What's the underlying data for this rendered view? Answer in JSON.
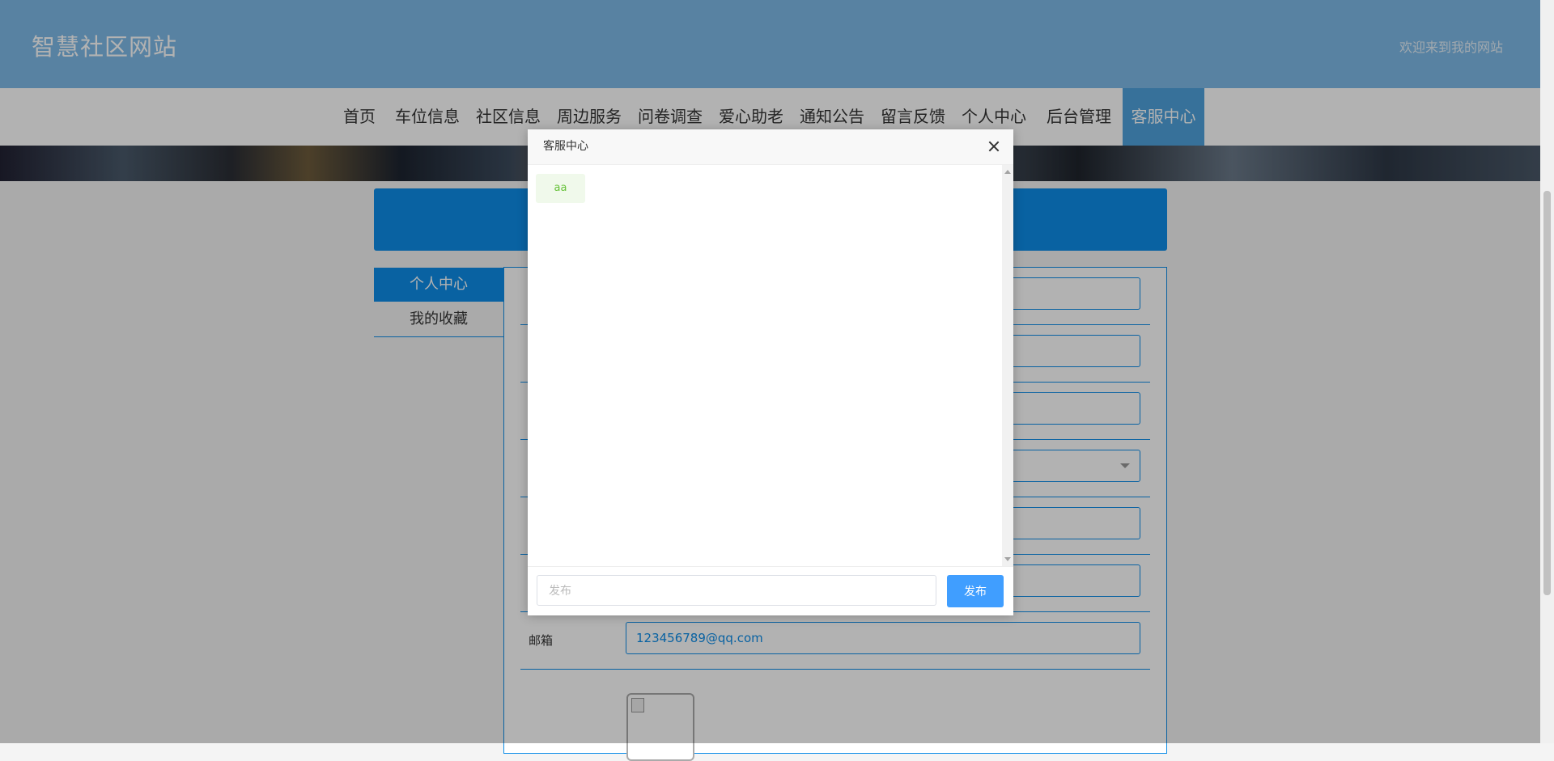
{
  "header": {
    "site_title": "智慧社区网站",
    "welcome_text": "欢迎来到我的网站"
  },
  "nav": {
    "items": [
      {
        "label": "首页"
      },
      {
        "label": "车位信息"
      },
      {
        "label": "社区信息"
      },
      {
        "label": "周边服务"
      },
      {
        "label": "问卷调查"
      },
      {
        "label": "爱心助老"
      },
      {
        "label": "通知公告"
      },
      {
        "label": "留言反馈"
      },
      {
        "label": "个人中心"
      },
      {
        "label": "后台管理"
      },
      {
        "label": "客服中心",
        "active": true
      }
    ]
  },
  "sidebar": {
    "items": [
      {
        "label": "个人中心",
        "active": true
      },
      {
        "label": "我的收藏"
      }
    ]
  },
  "form": {
    "email_label": "邮箱",
    "email_value": "123456789@qq.com"
  },
  "dialog": {
    "title": "客服中心",
    "messages": [
      {
        "text": "aa"
      }
    ],
    "input_placeholder": "发布",
    "send_label": "发布"
  },
  "colors": {
    "header_bg": "#7fbbe8",
    "primary": "#0d8de8",
    "send_button": "#409eff",
    "message_bubble_bg": "#f0f9eb",
    "message_bubble_text": "#67c23a"
  }
}
